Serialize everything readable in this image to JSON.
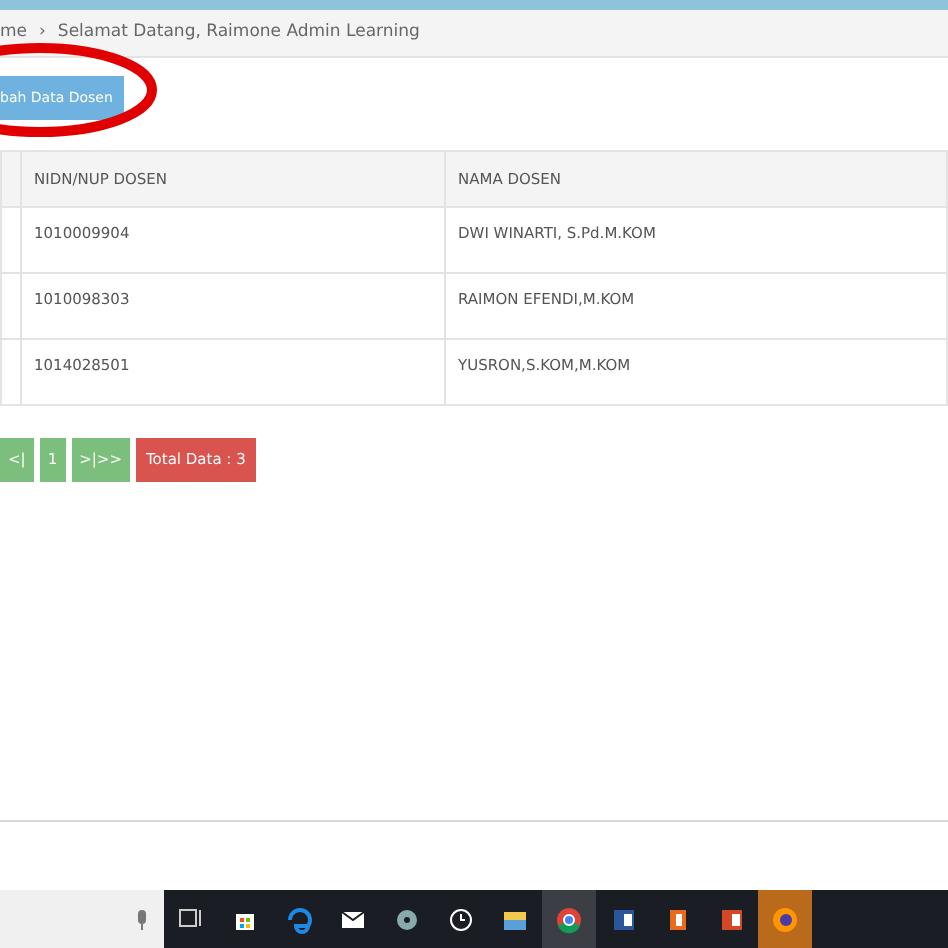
{
  "breadcrumb": {
    "home": "me",
    "separator": "›",
    "current": "Selamat Datang, Raimone Admin Learning"
  },
  "add_button": "bah Data Dosen",
  "table": {
    "columns": [
      "NIDN/NUP DOSEN",
      "NAMA DOSEN"
    ],
    "rows": [
      [
        "1010009904",
        "DWI WINARTI, S.Pd.M.KOM"
      ],
      [
        "1010098303",
        "RAIMON EFENDI,M.KOM"
      ],
      [
        "1014028501",
        "YUSRON,S.KOM,M.KOM"
      ]
    ]
  },
  "pagination": {
    "pages": [
      "<|",
      "1",
      ">|>>"
    ],
    "total": "Total Data : 3"
  },
  "taskbar": {
    "icons": [
      {
        "kind": "task-view",
        "hovered": false,
        "active": false
      },
      {
        "kind": "store",
        "hovered": false,
        "active": false
      },
      {
        "kind": "edge",
        "hovered": false,
        "active": false
      },
      {
        "kind": "mail",
        "hovered": false,
        "active": false
      },
      {
        "kind": "disc",
        "hovered": false,
        "active": false
      },
      {
        "kind": "alarm",
        "hovered": false,
        "active": false
      },
      {
        "kind": "folder",
        "hovered": false,
        "active": false
      },
      {
        "kind": "chrome",
        "hovered": true,
        "active": false
      },
      {
        "kind": "word",
        "hovered": false,
        "active": false
      },
      {
        "kind": "office",
        "hovered": false,
        "active": false
      },
      {
        "kind": "powerpoint",
        "hovered": false,
        "active": false
      },
      {
        "kind": "firefox",
        "hovered": false,
        "active": true
      }
    ]
  }
}
